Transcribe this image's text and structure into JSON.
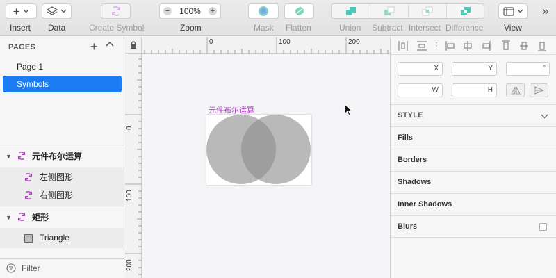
{
  "toolbar": {
    "insert": "Insert",
    "data": "Data",
    "create_symbol": "Create Symbol",
    "zoom": "Zoom",
    "zoom_value": "100%",
    "zoom_minus": "−",
    "zoom_plus": "+",
    "mask": "Mask",
    "flatten": "Flatten",
    "union": "Union",
    "subtract": "Subtract",
    "intersect": "Intersect",
    "difference": "Difference",
    "view": "View",
    "overflow": "»"
  },
  "pages": {
    "header": "PAGES",
    "plus": "+",
    "items": [
      "Page 1",
      "Symbols"
    ],
    "selected": "Symbols"
  },
  "layers": {
    "group1": "元件布尔运算",
    "group1_children": [
      "左侧图形",
      "右侧图形"
    ],
    "group2": "矩形",
    "group2_children": [
      "Triangle"
    ]
  },
  "filter": {
    "label": "Filter"
  },
  "canvas": {
    "ruler_top": [
      "0",
      "100",
      "200"
    ],
    "ruler_left": [
      "0",
      "100",
      "200"
    ],
    "artboard_title": "元件布尔运算"
  },
  "inspector": {
    "x": "X",
    "y": "Y",
    "rotation": "°",
    "w": "W",
    "h": "H",
    "style": "STYLE",
    "fills": "Fills",
    "borders": "Borders",
    "shadows": "Shadows",
    "inner_shadows": "Inner Shadows",
    "blurs": "Blurs"
  },
  "colors": {
    "selection": "#1b7cf4",
    "symbol_accent": "#b23cc6",
    "boolean_icon": "#4ec7b4",
    "circle_fill": "#8e8e8e"
  }
}
